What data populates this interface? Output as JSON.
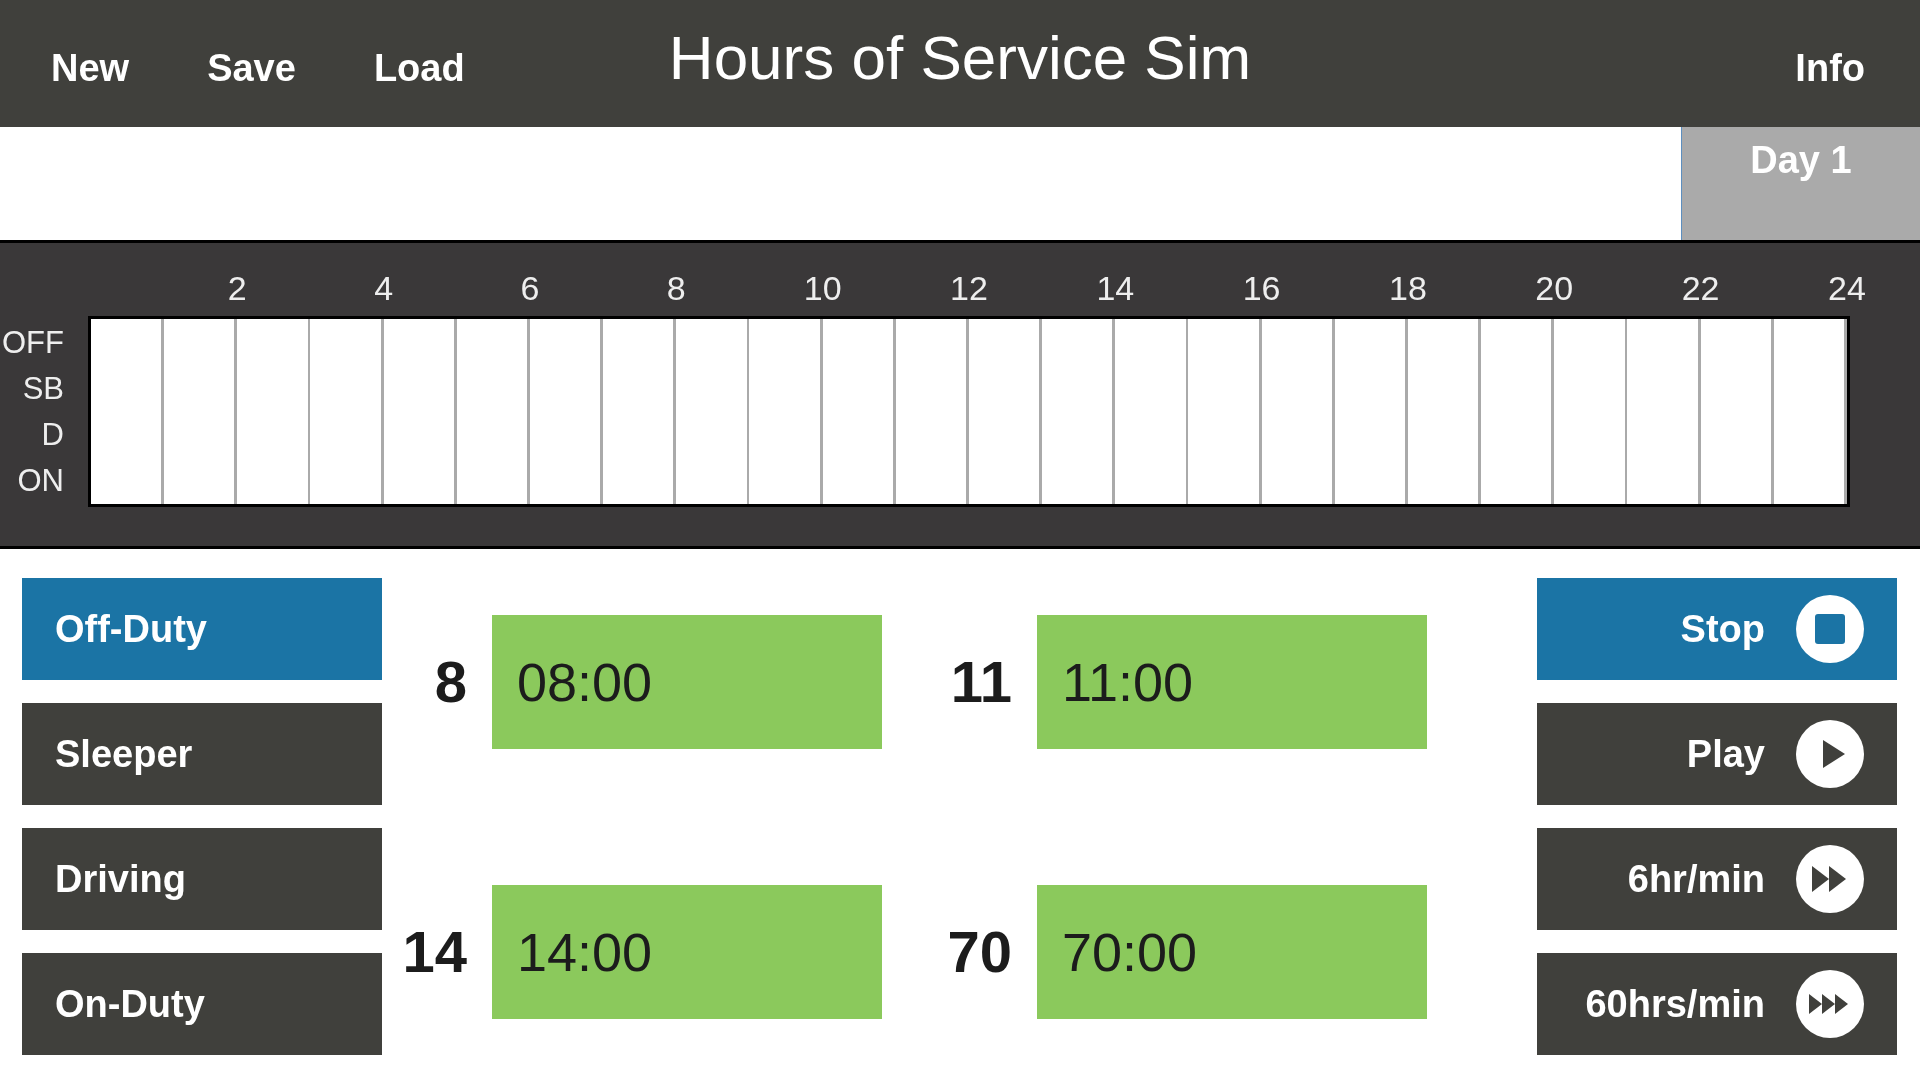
{
  "header": {
    "menu": [
      "New",
      "Save",
      "Load"
    ],
    "title": "Hours of Service Sim",
    "info": "Info"
  },
  "day_tabs": [
    {
      "label": "Day 1",
      "selected": true
    }
  ],
  "log_grid": {
    "hour_labels": [
      "2",
      "4",
      "6",
      "8",
      "10",
      "12",
      "14",
      "16",
      "18",
      "20",
      "22",
      "24"
    ],
    "status_labels": [
      "OFF",
      "SB",
      "D",
      "ON"
    ]
  },
  "status_buttons": [
    {
      "label": "Off-Duty",
      "selected": true
    },
    {
      "label": "Sleeper",
      "selected": false
    },
    {
      "label": "Driving",
      "selected": false
    },
    {
      "label": "On-Duty",
      "selected": false
    }
  ],
  "timers": [
    {
      "limit": "8",
      "value": "08:00"
    },
    {
      "limit": "11",
      "value": "11:00"
    },
    {
      "limit": "14",
      "value": "14:00"
    },
    {
      "limit": "70",
      "value": "70:00"
    }
  ],
  "playback": [
    {
      "label": "Stop",
      "kind": "stop",
      "selected": true
    },
    {
      "label": "Play",
      "kind": "play",
      "selected": false
    },
    {
      "label": "6hr/min",
      "kind": "fast",
      "selected": false
    },
    {
      "label": "60hrs/min",
      "kind": "fastest",
      "selected": false
    }
  ]
}
